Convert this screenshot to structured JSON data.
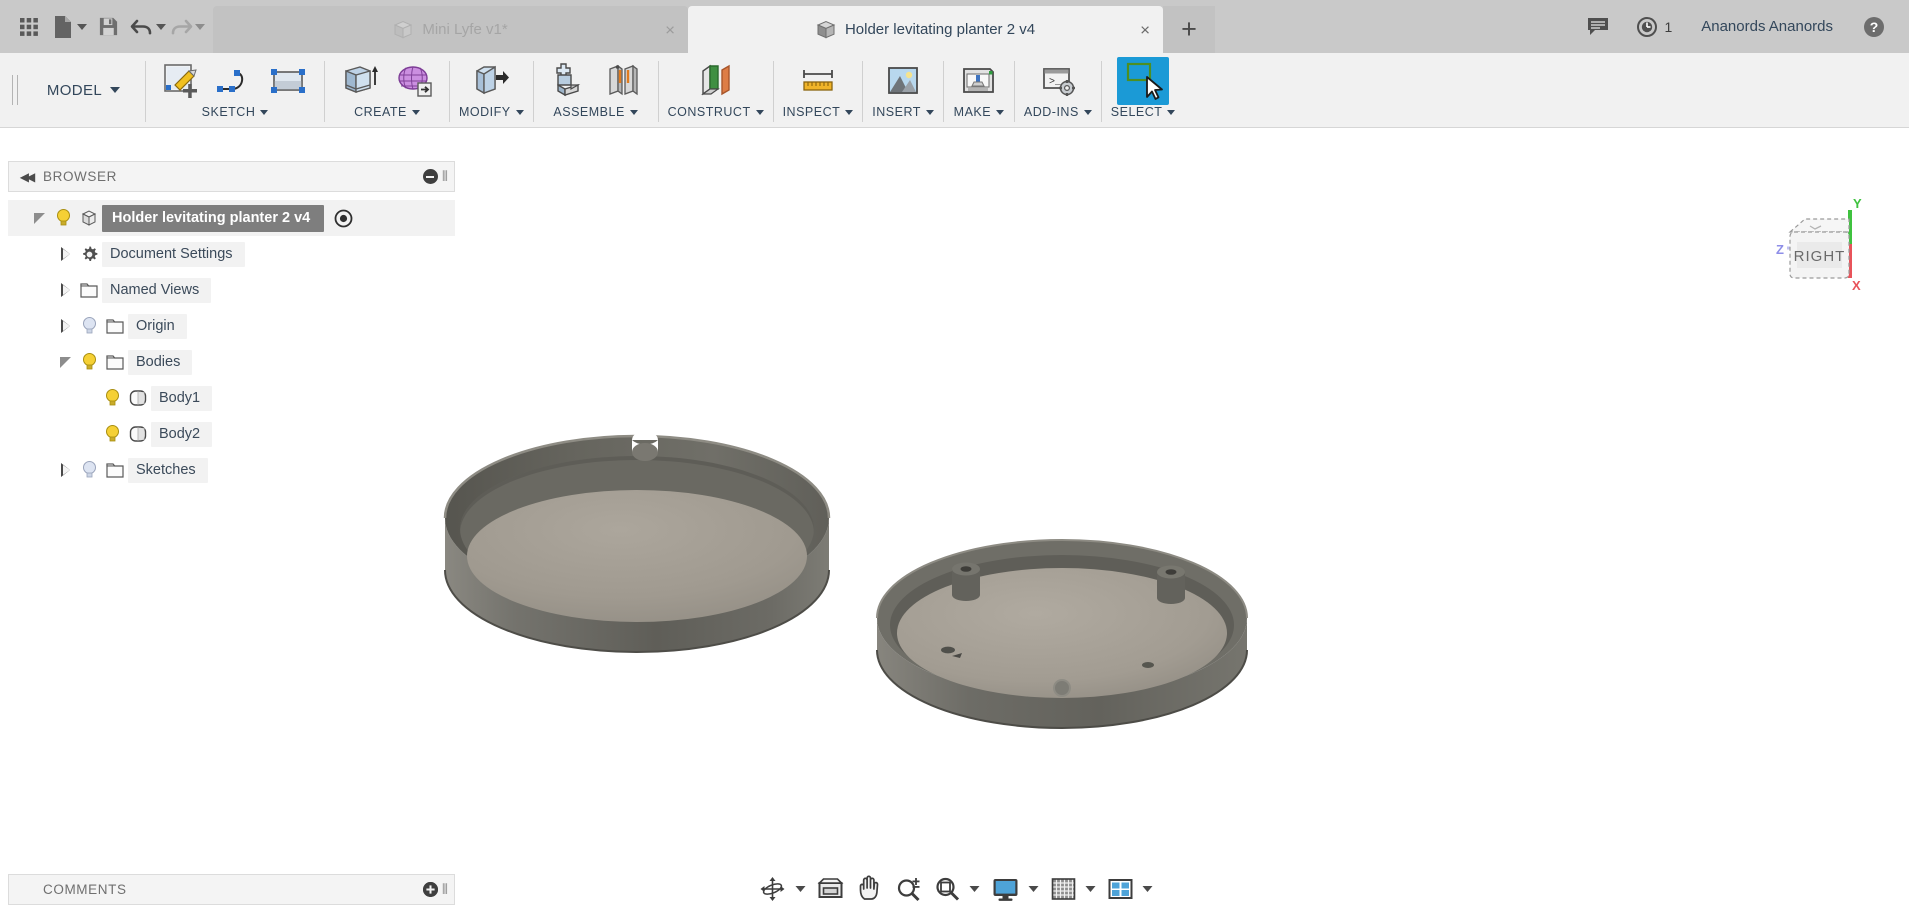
{
  "app": {
    "title": "Autodesk Fusion 360",
    "accent_color": "#1b9ad6",
    "header_bg": "#c9c9c9",
    "ribbon_bg": "#f1f1f1",
    "text_color": "#33475b"
  },
  "quick_access": {
    "items": [
      {
        "name": "app-grid",
        "icon": "grid-icon",
        "label": "Show Data Panel"
      },
      {
        "name": "new-file",
        "icon": "file-icon",
        "label": "File",
        "has_dropdown": true
      },
      {
        "name": "save",
        "icon": "save-icon",
        "label": "Save"
      },
      {
        "name": "undo",
        "icon": "undo-icon",
        "label": "Undo",
        "has_dropdown": true
      },
      {
        "name": "redo",
        "icon": "redo-icon",
        "label": "Redo",
        "has_dropdown": true,
        "disabled": true
      }
    ]
  },
  "tabs": [
    {
      "label": "Mini Lyfe v1*",
      "active": false,
      "close_label": "×"
    },
    {
      "label": "Holder levitating planter 2 v4",
      "active": true,
      "close_label": "×"
    }
  ],
  "tab_add_label": "+",
  "top_right": {
    "comments_icon": "comment-icon",
    "jobs_icon": "clock-icon",
    "jobs_count": "1",
    "username": "Ananords Ananords",
    "help_icon": "help-icon"
  },
  "ribbon": {
    "workspace": "MODEL",
    "groups": [
      {
        "label": "SKETCH",
        "name": "sketch",
        "buttons": [
          {
            "name": "create-sketch-button",
            "icon": "sketch-create-icon"
          },
          {
            "name": "line-button",
            "icon": "spline-icon"
          },
          {
            "name": "rectangle-button",
            "icon": "rectangle-icon"
          }
        ]
      },
      {
        "label": "CREATE",
        "name": "create",
        "buttons": [
          {
            "name": "extrude-button",
            "icon": "extrude-icon"
          },
          {
            "name": "create-form-button",
            "icon": "form-mesh-icon"
          }
        ]
      },
      {
        "label": "MODIFY",
        "name": "modify",
        "buttons": [
          {
            "name": "press-pull-button",
            "icon": "press-pull-icon"
          }
        ]
      },
      {
        "label": "ASSEMBLE",
        "name": "assemble",
        "buttons": [
          {
            "name": "new-component-button",
            "icon": "new-component-icon"
          },
          {
            "name": "joint-button",
            "icon": "joint-icon"
          }
        ]
      },
      {
        "label": "CONSTRUCT",
        "name": "construct",
        "buttons": [
          {
            "name": "offset-plane-button",
            "icon": "offset-plane-icon"
          }
        ]
      },
      {
        "label": "INSPECT",
        "name": "inspect",
        "buttons": [
          {
            "name": "measure-button",
            "icon": "ruler-icon"
          }
        ]
      },
      {
        "label": "INSERT",
        "name": "insert",
        "buttons": [
          {
            "name": "insert-mcmaster-button",
            "icon": "picture-icon"
          }
        ]
      },
      {
        "label": "MAKE",
        "name": "make",
        "buttons": [
          {
            "name": "3d-print-button",
            "icon": "printer-icon"
          }
        ]
      },
      {
        "label": "ADD-INS",
        "name": "add-ins",
        "buttons": [
          {
            "name": "scripts-addins-button",
            "icon": "console-gear-icon"
          }
        ]
      },
      {
        "label": "SELECT",
        "name": "select",
        "buttons": [
          {
            "name": "select-tool-button",
            "icon": "select-arrow-icon",
            "selected": true
          }
        ]
      }
    ]
  },
  "browser": {
    "header": {
      "title": "BROWSER",
      "collapse_icon": "collapse-left-icon",
      "action_icon": "minus-circle-icon",
      "dock_icon": "dock-handle-icon"
    },
    "tree": [
      {
        "label": "Holder levitating planter 2 v4",
        "indent": 0,
        "expander": "down",
        "bulb": "on",
        "icon": "component-icon",
        "selected": true,
        "trailing_icon": "target-icon"
      },
      {
        "label": "Document Settings",
        "indent": 1,
        "expander": "right",
        "bulb": "none",
        "icon": "gear-icon",
        "selected": false
      },
      {
        "label": "Named Views",
        "indent": 1,
        "expander": "right",
        "bulb": "none",
        "icon": "folder-icon",
        "selected": false
      },
      {
        "label": "Origin",
        "indent": 1,
        "expander": "right",
        "bulb": "off",
        "icon": "folder-icon",
        "selected": false
      },
      {
        "label": "Bodies",
        "indent": 1,
        "expander": "down",
        "bulb": "on",
        "icon": "folder-icon",
        "selected": false
      },
      {
        "label": "Body1",
        "indent": 2,
        "expander": "none",
        "bulb": "on",
        "icon": "body-icon",
        "selected": false
      },
      {
        "label": "Body2",
        "indent": 2,
        "expander": "none",
        "bulb": "on",
        "icon": "body-icon",
        "selected": false
      },
      {
        "label": "Sketches",
        "indent": 1,
        "expander": "right",
        "bulb": "off",
        "icon": "folder-icon",
        "selected": false
      }
    ]
  },
  "canvas": {
    "background": "#ffffff",
    "model_colors": {
      "outer_wall": "#61605a",
      "inner_floor": "#a09a91",
      "rim_top": "#8a8780",
      "shadow": "#4f4e49"
    },
    "bodies": [
      {
        "name": "Body1",
        "description": "Cylindrical planter bowl with notch in rim"
      },
      {
        "name": "Body2",
        "description": "Circular base plate with two posts and screw holes"
      }
    ],
    "viewcube": {
      "face_label": "RIGHT",
      "axis_x": "X",
      "axis_y": "Y",
      "axis_z": "Z",
      "color_x": "#e8535a",
      "color_y": "#3fc23f",
      "color_z": "#8e8ee8"
    }
  },
  "comments": {
    "title": "COMMENTS",
    "add_icon": "plus-circle-icon",
    "dock_icon": "dock-handle-icon"
  },
  "navbar": {
    "items": [
      {
        "name": "orbit-button",
        "icon": "orbit-icon",
        "has_dropdown": true
      },
      {
        "name": "look-at-button",
        "icon": "look-at-icon",
        "has_dropdown": false
      },
      {
        "name": "pan-button",
        "icon": "pan-hand-icon",
        "has_dropdown": false
      },
      {
        "name": "zoom-button",
        "icon": "zoom-icon",
        "has_dropdown": false
      },
      {
        "name": "fit-button",
        "icon": "fit-icon",
        "has_dropdown": true
      },
      {
        "name": "display-settings-button",
        "icon": "monitor-icon",
        "has_dropdown": true
      },
      {
        "name": "grid-snaps-button",
        "icon": "grid-snap-icon",
        "has_dropdown": true
      },
      {
        "name": "viewports-button",
        "icon": "viewports-icon",
        "has_dropdown": true
      }
    ]
  }
}
